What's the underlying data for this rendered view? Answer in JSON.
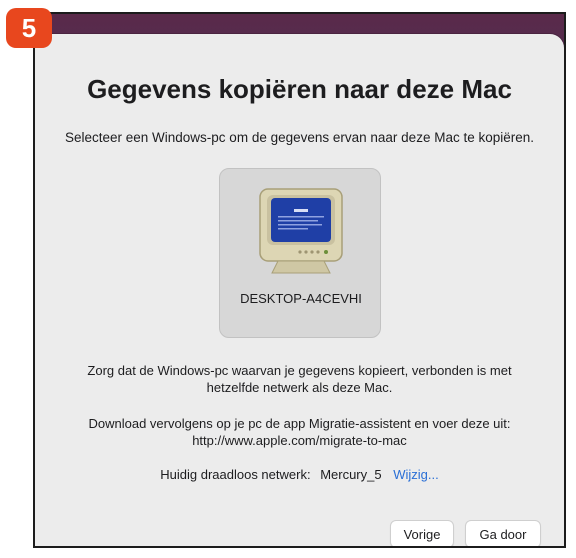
{
  "step_badge": "5",
  "dialog": {
    "title": "Gegevens kopiëren naar deze Mac",
    "subtitle": "Selecteer een Windows-pc om de gegevens ervan naar deze Mac te kopiëren."
  },
  "computer": {
    "name": "DESKTOP-A4CEVHI",
    "icon": "windows-pc-monitor-icon"
  },
  "info": {
    "line1a": "Zorg dat de Windows-pc waarvan je gegevens kopieert, verbonden is met",
    "line1b": "hetzelfde netwerk als deze Mac.",
    "line2a": "Download vervolgens op je pc de app Migratie-assistent en voer deze uit:",
    "line2b": "http://www.apple.com/migrate-to-mac"
  },
  "network": {
    "label": "Huidig draadloos netwerk:",
    "value": "Mercury_5",
    "change_link": "Wijzig..."
  },
  "buttons": {
    "back": "Vorige",
    "next": "Ga door"
  },
  "colors": {
    "badge": "#e8471e",
    "link": "#2a6fd6",
    "sheet": "#ececec"
  }
}
